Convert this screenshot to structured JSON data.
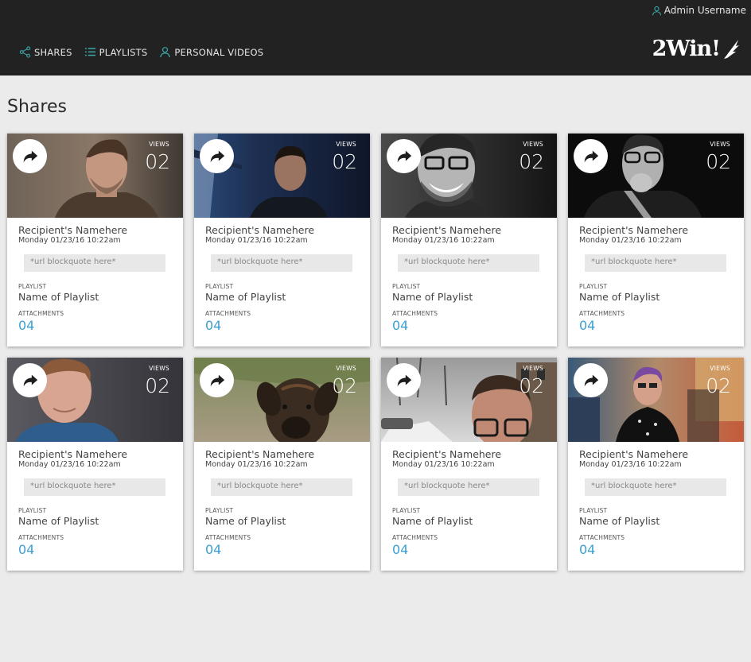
{
  "header": {
    "user": "Admin Username",
    "nav": [
      {
        "label": "SHARES",
        "icon": "share-icon"
      },
      {
        "label": "PLAYLISTS",
        "icon": "list-icon"
      },
      {
        "label": "PERSONAL VIDEOS",
        "icon": "user-icon"
      }
    ],
    "logo": "2Win!"
  },
  "page": {
    "title": "Shares"
  },
  "cards": [
    {
      "views_label": "VIEWS",
      "views": "02",
      "recipient": "Recipient's Namehere",
      "date": "Monday 01/23/16 10:22am",
      "quote": "*url blockquote here*",
      "playlist_label": "PLAYLIST",
      "playlist": "Name of Playlist",
      "attachments_label": "ATTACHMENTS",
      "attachments": "04",
      "photo": "man-portrait"
    },
    {
      "views_label": "VIEWS",
      "views": "02",
      "recipient": "Recipient's Namehere",
      "date": "Monday 01/23/16 10:22am",
      "quote": "*url blockquote here*",
      "playlist_label": "PLAYLIST",
      "playlist": "Name of Playlist",
      "attachments_label": "ATTACHMENTS",
      "attachments": "04",
      "photo": "man-blue-portrait"
    },
    {
      "views_label": "VIEWS",
      "views": "02",
      "recipient": "Recipient's Namehere",
      "date": "Monday 01/23/16 10:22am",
      "quote": "*url blockquote here*",
      "playlist_label": "PLAYLIST",
      "playlist": "Name of Playlist",
      "attachments_label": "ATTACHMENTS",
      "attachments": "04",
      "photo": "smiling-man-bw"
    },
    {
      "views_label": "VIEWS",
      "views": "02",
      "recipient": "Recipient's Namehere",
      "date": "Monday 01/23/16 10:22am",
      "quote": "*url blockquote here*",
      "playlist_label": "PLAYLIST",
      "playlist": "Name of Playlist",
      "attachments_label": "ATTACHMENTS",
      "attachments": "04",
      "photo": "man-glasses-bw"
    },
    {
      "views_label": "VIEWS",
      "views": "02",
      "recipient": "Recipient's Namehere",
      "date": "Monday 01/23/16 10:22am",
      "quote": "*url blockquote here*",
      "playlist_label": "PLAYLIST",
      "playlist": "Name of Playlist",
      "attachments_label": "ATTACHMENTS",
      "attachments": "04",
      "photo": "young-man"
    },
    {
      "views_label": "VIEWS",
      "views": "02",
      "recipient": "Recipient's Namehere",
      "date": "Monday 01/23/16 10:22am",
      "quote": "*url blockquote here*",
      "playlist_label": "PLAYLIST",
      "playlist": "Name of Playlist",
      "attachments_label": "ATTACHMENTS",
      "attachments": "04",
      "photo": "dog"
    },
    {
      "views_label": "VIEWS",
      "views": "02",
      "recipient": "Recipient's Namehere",
      "date": "Monday 01/23/16 10:22am",
      "quote": "*url blockquote here*",
      "playlist_label": "PLAYLIST",
      "playlist": "Name of Playlist",
      "attachments_label": "ATTACHMENTS",
      "attachments": "04",
      "photo": "man-street"
    },
    {
      "views_label": "VIEWS",
      "views": "02",
      "recipient": "Recipient's Namehere",
      "date": "Monday 01/23/16 10:22am",
      "quote": "*url blockquote here*",
      "playlist_label": "PLAYLIST",
      "playlist": "Name of Playlist",
      "attachments_label": "ATTACHMENTS",
      "attachments": "04",
      "photo": "party"
    }
  ],
  "colors": {
    "header_bg": "#222223",
    "accent": "#3a9fd1",
    "nav_icon": "#3ba7a7"
  }
}
